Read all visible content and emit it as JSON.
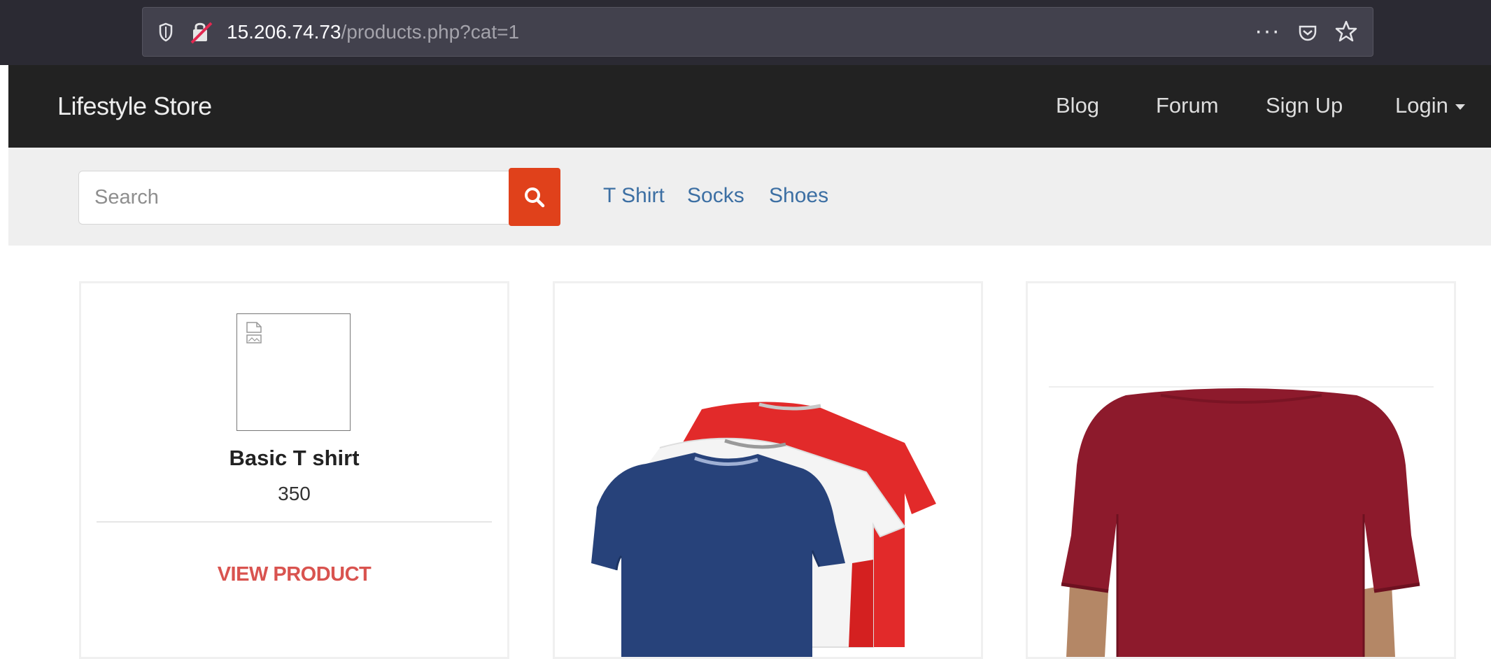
{
  "browser": {
    "url_host": "15.206.74.73",
    "url_path": "/products.php?cat=1",
    "more_label": "···",
    "icons": [
      "shield-icon",
      "insecure-lock-icon",
      "pocket-icon",
      "bookmark-star-icon"
    ]
  },
  "navbar": {
    "brand": "Lifestyle Store",
    "links": [
      "Blog",
      "Forum",
      "Sign Up",
      "Login"
    ]
  },
  "search": {
    "placeholder": "Search",
    "button_icon": "search-icon"
  },
  "categories": [
    "T Shirt",
    "Socks",
    "Shoes"
  ],
  "products": [
    {
      "name": "Basic T shirt",
      "price": "350",
      "action": "VIEW PRODUCT",
      "image": "broken-image-icon"
    },
    {
      "image": "tshirt-stack-photo"
    },
    {
      "image": "maroon-longsleeve-photo"
    }
  ],
  "colors": {
    "navbar_bg": "#222222",
    "search_button": "#e0411b",
    "category_link": "#3c6fa3",
    "view_product": "#d9534f"
  }
}
